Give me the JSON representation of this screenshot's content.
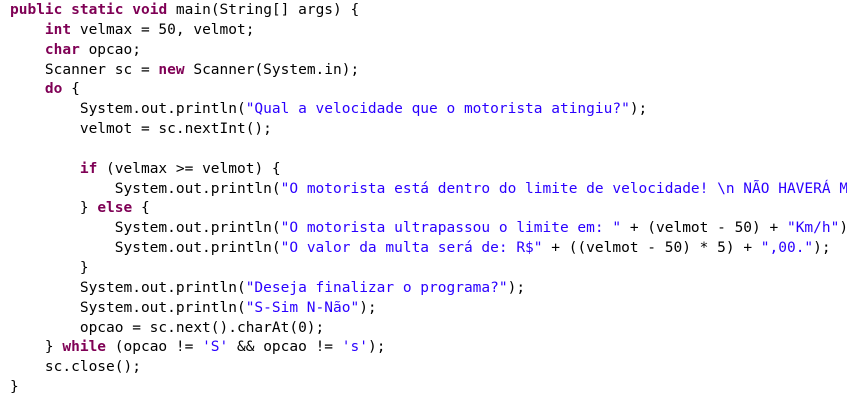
{
  "code_lines": [
    [
      {
        "t": "kw",
        "v": "public"
      },
      {
        "t": "plain",
        "v": " "
      },
      {
        "t": "kw",
        "v": "static"
      },
      {
        "t": "plain",
        "v": " "
      },
      {
        "t": "kw",
        "v": "void"
      },
      {
        "t": "plain",
        "v": " main(String[] args) {"
      }
    ],
    [
      {
        "t": "plain",
        "v": "    "
      },
      {
        "t": "kw",
        "v": "int"
      },
      {
        "t": "plain",
        "v": " velmax = 50, velmot;"
      }
    ],
    [
      {
        "t": "plain",
        "v": "    "
      },
      {
        "t": "kw",
        "v": "char"
      },
      {
        "t": "plain",
        "v": " opcao;"
      }
    ],
    [
      {
        "t": "plain",
        "v": "    Scanner sc = "
      },
      {
        "t": "kw",
        "v": "new"
      },
      {
        "t": "plain",
        "v": " Scanner(System.in);"
      }
    ],
    [
      {
        "t": "plain",
        "v": "    "
      },
      {
        "t": "kw",
        "v": "do"
      },
      {
        "t": "plain",
        "v": " {"
      }
    ],
    [
      {
        "t": "plain",
        "v": "        System.out.println("
      },
      {
        "t": "str",
        "v": "\"Qual a velocidade que o motorista atingiu?\""
      },
      {
        "t": "plain",
        "v": ");"
      }
    ],
    [
      {
        "t": "plain",
        "v": "        velmot = sc.nextInt();"
      }
    ],
    [
      {
        "t": "plain",
        "v": ""
      }
    ],
    [
      {
        "t": "plain",
        "v": "        "
      },
      {
        "t": "kw",
        "v": "if"
      },
      {
        "t": "plain",
        "v": " (velmax >= velmot) {"
      }
    ],
    [
      {
        "t": "plain",
        "v": "            System.out.println("
      },
      {
        "t": "str",
        "v": "\"O motorista está dentro do limite de velocidade! \\n NÃO HAVERÁ MULTA!\""
      },
      {
        "t": "plain",
        "v": ");"
      }
    ],
    [
      {
        "t": "plain",
        "v": "        } "
      },
      {
        "t": "kw",
        "v": "else"
      },
      {
        "t": "plain",
        "v": " {"
      }
    ],
    [
      {
        "t": "plain",
        "v": "            System.out.println("
      },
      {
        "t": "str",
        "v": "\"O motorista ultrapassou o limite em: \""
      },
      {
        "t": "plain",
        "v": " + (velmot - 50) + "
      },
      {
        "t": "str",
        "v": "\"Km/h\""
      },
      {
        "t": "plain",
        "v": ");"
      }
    ],
    [
      {
        "t": "plain",
        "v": "            System.out.println("
      },
      {
        "t": "str",
        "v": "\"O valor da multa será de: R$\""
      },
      {
        "t": "plain",
        "v": " + ((velmot - 50) * 5) + "
      },
      {
        "t": "str",
        "v": "\",00.\""
      },
      {
        "t": "plain",
        "v": ");"
      }
    ],
    [
      {
        "t": "plain",
        "v": "        }"
      }
    ],
    [
      {
        "t": "plain",
        "v": "        System.out.println("
      },
      {
        "t": "str",
        "v": "\"Deseja finalizar o programa?\""
      },
      {
        "t": "plain",
        "v": ");"
      }
    ],
    [
      {
        "t": "plain",
        "v": "        System.out.println("
      },
      {
        "t": "str",
        "v": "\"S-Sim N-Não\""
      },
      {
        "t": "plain",
        "v": ");"
      }
    ],
    [
      {
        "t": "plain",
        "v": "        opcao = sc.next().charAt(0);"
      }
    ],
    [
      {
        "t": "plain",
        "v": "    } "
      },
      {
        "t": "kw",
        "v": "while"
      },
      {
        "t": "plain",
        "v": " (opcao != "
      },
      {
        "t": "str",
        "v": "'S'"
      },
      {
        "t": "plain",
        "v": " && opcao != "
      },
      {
        "t": "str",
        "v": "'s'"
      },
      {
        "t": "plain",
        "v": ");"
      }
    ],
    [
      {
        "t": "plain",
        "v": "    sc.close();"
      }
    ],
    [
      {
        "t": "plain",
        "v": "}"
      }
    ]
  ],
  "colors": {
    "keyword": "#7f0055",
    "string": "#2a00ff",
    "text": "#000000",
    "background": "#ffffff"
  }
}
